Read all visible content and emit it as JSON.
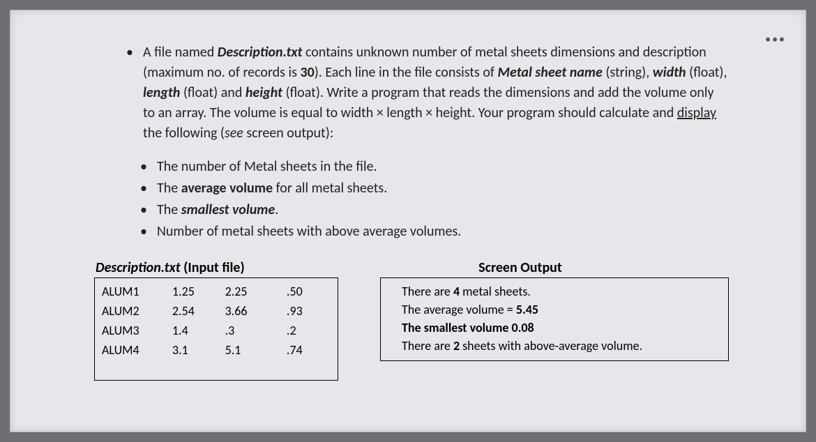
{
  "more": "•••",
  "bullets": {
    "intro": {
      "p1a": "A file named ",
      "file": "Description.txt",
      "p1b": " contains unknown number of metal sheets dimensions and description (maximum no. of records is ",
      "max": "30",
      "p1c": "). Each line in the file consists of ",
      "f1": "Metal sheet name",
      "p1d": " (string), ",
      "f2": "width",
      "p1e": " (float), ",
      "f3": "length",
      "p1f": " (float) and ",
      "f4": "height",
      "p1g": " (float). Write a program that reads the dimensions and add the volume only to an array.  The volume is equal to width × length × height. Your program should calculate and ",
      "disp": "display",
      "p1h": " the following (",
      "see": "see",
      "p1i": " screen output):"
    },
    "sub": {
      "s1": "The number of Metal sheets in the file.",
      "s2a": "The ",
      "s2b": "average volume",
      "s2c": " for all metal sheets.",
      "s3a": "The ",
      "s3b": "smallest volume",
      "s3c": ".",
      "s4": "Number of metal sheets with above average volumes."
    }
  },
  "inputTitle_a": "Description.txt",
  "inputTitle_b": " (Input file)",
  "outputTitle": "Screen Output",
  "table": {
    "rows": [
      {
        "c1": "ALUM1",
        "c2": "1.25",
        "c3": "2.25",
        "c4": ".50"
      },
      {
        "c1": "ALUM2",
        "c2": "2.54",
        "c3": "3.66",
        "c4": ".93"
      },
      {
        "c1": "ALUM3",
        "c2": "1.4",
        "c3": ".3",
        "c4": ".2"
      },
      {
        "c1": "ALUM4",
        "c2": "3.1",
        "c3": "5.1",
        "c4": ".74"
      }
    ]
  },
  "output": {
    "l1a": "There are ",
    "l1b": "4",
    "l1c": " metal sheets.",
    "l2a": "The average volume = ",
    "l2b": "5.45",
    "l3a": "The smallest volume ",
    "l3b": "0.08",
    "l4a": "There are ",
    "l4b": "2",
    "l4c": " sheets with above-average volume."
  }
}
